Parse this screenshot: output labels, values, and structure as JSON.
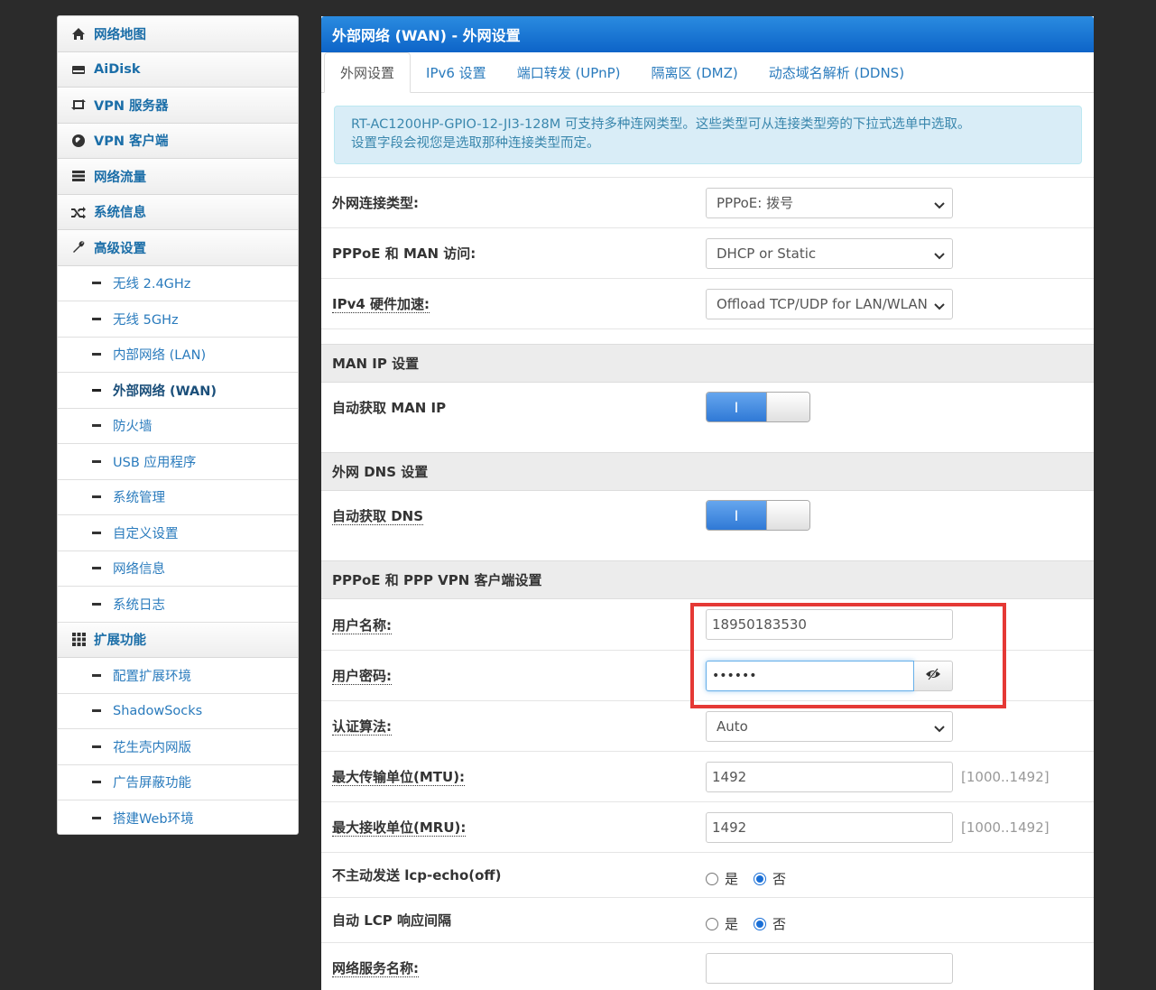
{
  "sidebar": {
    "items": [
      {
        "label": "网络地图",
        "icon": "home-icon"
      },
      {
        "label": "AiDisk",
        "icon": "hdd-icon"
      },
      {
        "label": "VPN 服务器",
        "icon": "retweet-icon"
      },
      {
        "label": "VPN 客户端",
        "icon": "globe-icon"
      },
      {
        "label": "网络流量",
        "icon": "tasks-icon"
      },
      {
        "label": "系统信息",
        "icon": "random-icon"
      },
      {
        "label": "高级设置",
        "icon": "wrench-icon"
      }
    ],
    "advanced_sub": [
      "无线 2.4GHz",
      "无线 5GHz",
      "内部网络 (LAN)",
      "外部网络 (WAN)",
      "防火墙",
      "USB 应用程序",
      "系统管理",
      "自定义设置",
      "网络信息",
      "系统日志"
    ],
    "ext_label": "扩展功能",
    "ext_icon": "th-icon",
    "ext_sub": [
      "配置扩展环境",
      "ShadowSocks",
      "花生壳内网版",
      "广告屏蔽功能",
      "搭建Web环境"
    ]
  },
  "panel": {
    "title": "外部网络 (WAN) - 外网设置",
    "tabs": [
      "外网设置",
      "IPv6 设置",
      "端口转发 (UPnP)",
      "隔离区 (DMZ)",
      "动态域名解析 (DDNS)"
    ],
    "info_line1": "RT-AC1200HP-GPIO-12-JI3-128M 可支持多种连网类型。这些类型可从连接类型旁的下拉式选单中选取。",
    "info_line2": "设置字段会视您是选取那种连接类型而定。"
  },
  "form": {
    "wan_type_label": "外网连接类型:",
    "wan_type_value": "PPPoE: 拨号",
    "man_access_label": "PPPoE 和 MAN 访问:",
    "man_access_value": "DHCP or Static",
    "hw_accel_label": "IPv4 硬件加速:",
    "hw_accel_value": "Offload TCP/UDP for LAN/WLAN",
    "section_man": "MAN IP 设置",
    "auto_man_ip_label": "自动获取 MAN IP",
    "toggle_on": "I",
    "section_dns": "外网 DNS 设置",
    "auto_dns_label": "自动获取 DNS",
    "section_pppoe": "PPPoE 和 PPP VPN 客户端设置",
    "username_label": "用户名称:",
    "username_value": "18950183530",
    "password_label": "用户密码:",
    "password_value": "••••••",
    "auth_label": "认证算法:",
    "auth_value": "Auto",
    "mtu_label": "最大传输单位(MTU):",
    "mtu_value": "1492",
    "mtu_range": "[1000..1492]",
    "mru_label": "最大接收单位(MRU):",
    "mru_value": "1492",
    "mru_range": "[1000..1492]",
    "lcp_echo_label": "不主动发送 lcp-echo(off)",
    "lcp_adaptive_label": "自动 LCP 响应间隔",
    "yes": "是",
    "no": "否",
    "service_name_label": "网络服务名称:",
    "service_name_value": ""
  },
  "colors": {
    "header_blue": "#0d64c8",
    "link_blue": "#2a7bbd",
    "highlight_red": "#e53935"
  }
}
